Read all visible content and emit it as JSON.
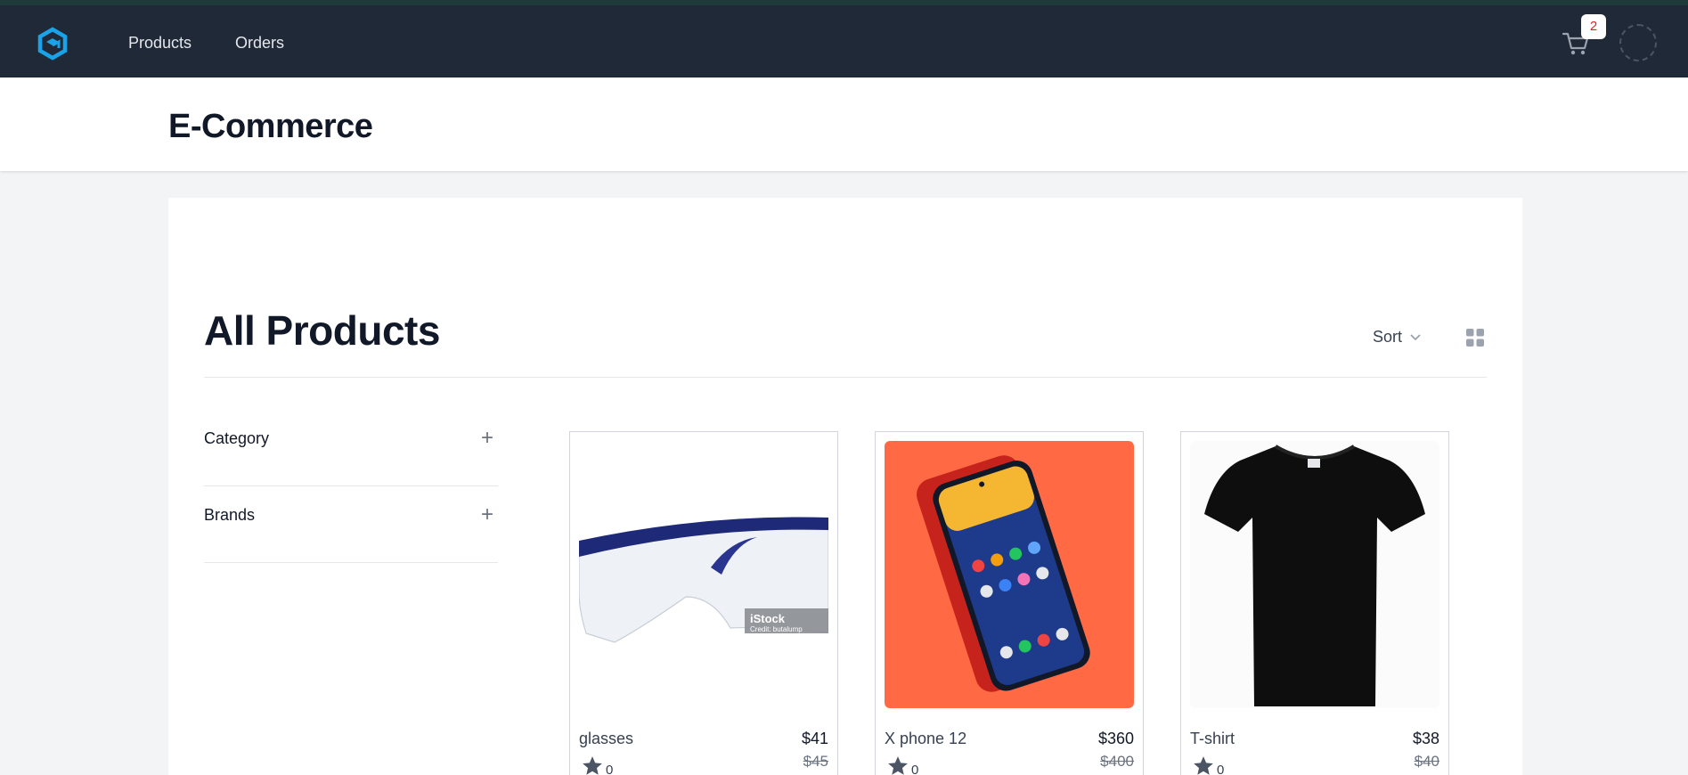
{
  "nav": {
    "products": "Products",
    "orders": "Orders",
    "cart_count": "2"
  },
  "header": {
    "title": "E-Commerce"
  },
  "main": {
    "title": "All Products",
    "sort_label": "Sort"
  },
  "filters": [
    {
      "label": "Category"
    },
    {
      "label": "Brands"
    }
  ],
  "products": [
    {
      "name": "glasses",
      "price": "$41",
      "old_price": "$45",
      "rating": "0",
      "watermark": "iStock",
      "watermark_credit": "Credit: butalump"
    },
    {
      "name": "X phone 12",
      "price": "$360",
      "old_price": "$400",
      "rating": "0"
    },
    {
      "name": "T-shirt",
      "price": "$38",
      "old_price": "$40",
      "rating": "0"
    }
  ],
  "colors": {
    "navbar": "#1f2937",
    "accent": "#1aa3e8",
    "phone_bg": "#ff6a45"
  }
}
